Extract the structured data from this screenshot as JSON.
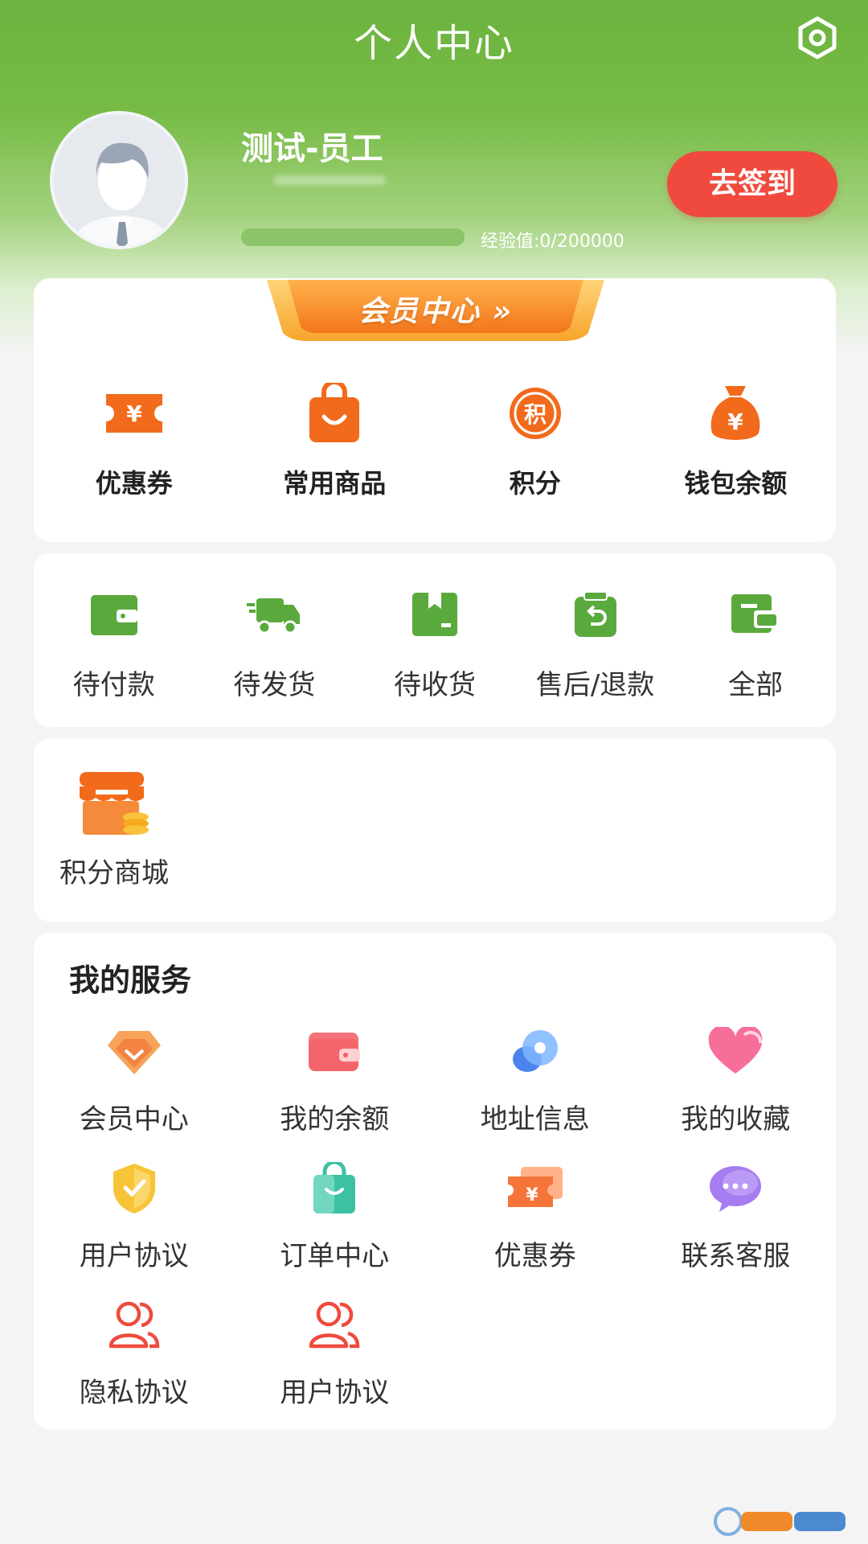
{
  "header": {
    "title": "个人中心"
  },
  "user": {
    "name": "测试-员工",
    "exp_label": "经验值:0/200000",
    "exp_progress": 0,
    "checkin_label": "去签到"
  },
  "member": {
    "banner_label": "会员中心",
    "items": [
      {
        "label": "优惠券",
        "icon": "coupon-icon"
      },
      {
        "label": "常用商品",
        "icon": "shopping-bag-icon"
      },
      {
        "label": "积分",
        "icon": "points-icon"
      },
      {
        "label": "钱包余额",
        "icon": "money-bag-icon"
      }
    ]
  },
  "orders": {
    "items": [
      {
        "label": "待付款",
        "icon": "wallet-icon"
      },
      {
        "label": "待发货",
        "icon": "truck-icon"
      },
      {
        "label": "待收货",
        "icon": "package-icon"
      },
      {
        "label": "售后/退款",
        "icon": "refund-icon"
      },
      {
        "label": "全部",
        "icon": "all-orders-icon"
      }
    ]
  },
  "mall": {
    "label": "积分商城",
    "icon": "store-icon"
  },
  "services": {
    "title": "我的服务",
    "items": [
      {
        "label": "会员中心",
        "icon": "diamond-icon"
      },
      {
        "label": "我的余额",
        "icon": "wallet-icon"
      },
      {
        "label": "地址信息",
        "icon": "location-icon"
      },
      {
        "label": "我的收藏",
        "icon": "heart-icon"
      },
      {
        "label": "用户协议",
        "icon": "shield-icon"
      },
      {
        "label": "订单中心",
        "icon": "bag-icon"
      },
      {
        "label": "优惠券",
        "icon": "coupon-icon"
      },
      {
        "label": "联系客服",
        "icon": "chat-icon"
      },
      {
        "label": "隐私协议",
        "icon": "users-icon"
      },
      {
        "label": "用户协议",
        "icon": "users-icon"
      }
    ]
  },
  "colors": {
    "primary_green": "#6cb33f",
    "order_icon_green": "#5aa93c",
    "orange": "#f26a1b",
    "checkin_red": "#ef4a3d"
  }
}
